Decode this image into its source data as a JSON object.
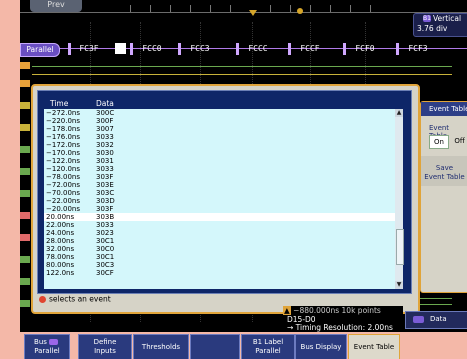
{
  "top": {
    "prev_label": "Prev",
    "vertical_label": "Vertical",
    "vertical_value": "3.76 div",
    "vertical_badge": "B1"
  },
  "bus": {
    "tag": "Parallel",
    "values": [
      "FC3F",
      "FCC0",
      "FCC3",
      "FCCC",
      "FCCF",
      "FCF0",
      "FCF3"
    ]
  },
  "event_table": {
    "columns": [
      "Time",
      "Data"
    ],
    "rows": [
      [
        "−272.0ns",
        "300C"
      ],
      [
        "−220.0ns",
        "300F"
      ],
      [
        "−178.0ns",
        "3007"
      ],
      [
        "−176.0ns",
        "3033"
      ],
      [
        "−172.0ns",
        "3032"
      ],
      [
        "−170.0ns",
        "3030"
      ],
      [
        "−122.0ns",
        "3031"
      ],
      [
        "−120.0ns",
        "3033"
      ],
      [
        "−78.00ns",
        "303F"
      ],
      [
        "−72.00ns",
        "303E"
      ],
      [
        "−70.00ns",
        "303C"
      ],
      [
        "−22.00ns",
        "303D"
      ],
      [
        "−20.00ns",
        "303F"
      ],
      [
        "20.00ns",
        "303B"
      ],
      [
        "22.00ns",
        "3033"
      ],
      [
        "24.00ns",
        "3023"
      ],
      [
        "28.00ns",
        "30C1"
      ],
      [
        "32.00ns",
        "30C0"
      ],
      [
        "78.00ns",
        "30C1"
      ],
      [
        "80.00ns",
        "30C3"
      ],
      [
        "122.0ns",
        "30CF"
      ]
    ],
    "selected_index": 13,
    "hint": "selects an event"
  },
  "side_panel": {
    "header": "Event Table",
    "sub_label": "Event Table",
    "on_label": "On",
    "off_label": "Off",
    "save_line1": "Save",
    "save_line2": "Event Table"
  },
  "status": {
    "line1_left": "▲",
    "line1_value": "−880.000ns",
    "line1_points": "10k points",
    "line2": "D15-D0",
    "line3": "→ Timing Resolution: 2.00ns"
  },
  "data_tab": {
    "badge": "B1",
    "label": "Data"
  },
  "softkeys": [
    {
      "line1": "Bus",
      "badge": "B1",
      "line2": "Parallel"
    },
    {
      "line1": "Define",
      "line2": "Inputs"
    },
    {
      "single": "Thresholds"
    },
    {
      "single": ""
    },
    {
      "line1": "B1 Label",
      "line2": "Parallel"
    },
    {
      "single": "Bus Display"
    },
    {
      "single": "Event Table"
    }
  ],
  "colors": {
    "bezel": "#f4b8a8",
    "dialog_border": "#e0a43a",
    "bus_purple": "#b07ae8",
    "table_bg": "#d4f7fb",
    "softkey_blue": "#2a3a7e"
  }
}
